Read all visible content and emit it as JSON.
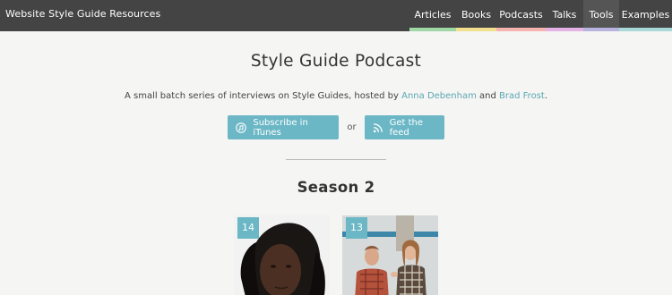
{
  "header": {
    "site_title": "Website Style Guide Resources",
    "nav": [
      {
        "label": "Articles",
        "color": "#9fd7a5",
        "active": false
      },
      {
        "label": "Books",
        "color": "#f2e08f",
        "active": false
      },
      {
        "label": "Podcasts",
        "color": "#f4b3ae",
        "active": false
      },
      {
        "label": "Talks",
        "color": "#e5b2e6",
        "active": false
      },
      {
        "label": "Tools",
        "color": "#b9b3e0",
        "active": true
      },
      {
        "label": "Examples",
        "color": "#a9d8d8",
        "active": false
      }
    ]
  },
  "main": {
    "title": "Style Guide Podcast",
    "intro_prefix": "A small batch series of interviews on Style Guides, hosted by ",
    "host1": "Anna Debenham",
    "intro_and": " and ",
    "host2": "Brad Frost",
    "intro_suffix": ".",
    "subscribe_label": "Subscribe in iTunes",
    "or_label": "or",
    "feed_label": "Get the feed",
    "season_title": "Season 2"
  },
  "episodes": [
    {
      "number": "14"
    },
    {
      "number": "13"
    }
  ],
  "colors": {
    "accent": "#6bb7c5",
    "link": "#5aa6b4",
    "topbar": "#444444"
  },
  "icons": {
    "itunes": "music-note-circle-icon",
    "feed": "rss-icon"
  }
}
